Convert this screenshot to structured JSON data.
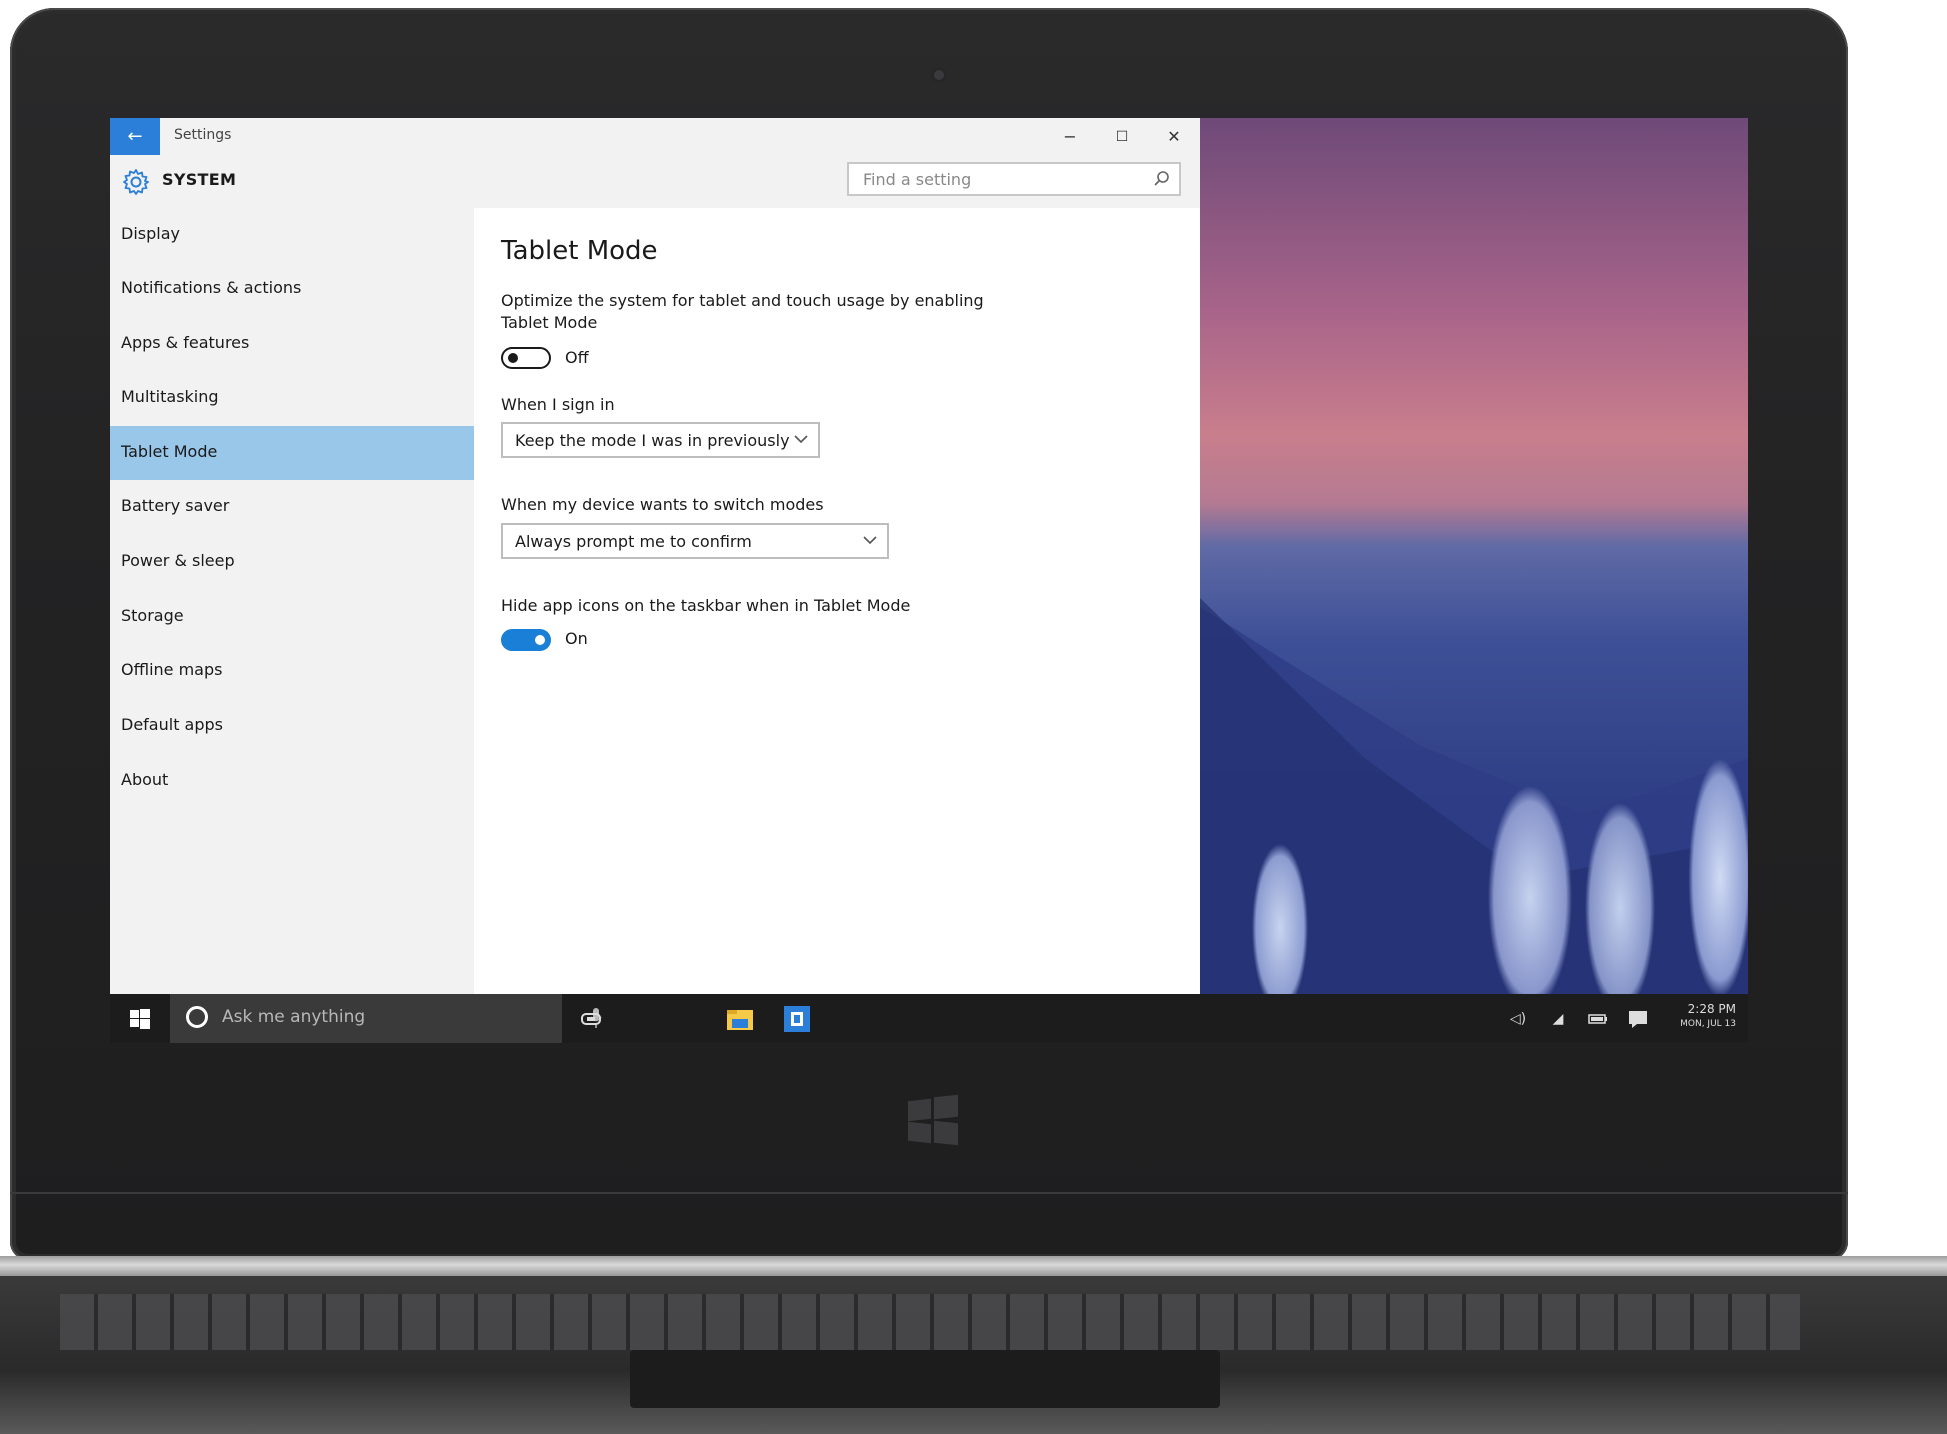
{
  "window": {
    "title": "Settings",
    "back_icon": "←",
    "minimize_icon": "−",
    "maximize_icon": "☐",
    "close_icon": "✕"
  },
  "header": {
    "section": "SYSTEM",
    "search_placeholder": "Find a setting"
  },
  "sidebar": {
    "items": [
      {
        "label": "Display"
      },
      {
        "label": "Notifications & actions"
      },
      {
        "label": "Apps & features"
      },
      {
        "label": "Multitasking"
      },
      {
        "label": "Tablet Mode",
        "selected": true
      },
      {
        "label": "Battery saver"
      },
      {
        "label": "Power & sleep"
      },
      {
        "label": "Storage"
      },
      {
        "label": "Offline maps"
      },
      {
        "label": "Default apps"
      },
      {
        "label": "About"
      }
    ]
  },
  "content": {
    "title": "Tablet Mode",
    "optimize_desc": "Optimize the system for tablet and touch usage by enabling Tablet Mode",
    "tablet_toggle": {
      "state": "Off",
      "on": false
    },
    "signin_label": "When I sign in",
    "signin_value": "Keep the mode I was in previously",
    "switch_label": "When my device wants to switch modes",
    "switch_value": "Always prompt me to confirm",
    "hide_icons_label": "Hide app icons on the taskbar when in Tablet Mode",
    "hide_icons_toggle": {
      "state": "On",
      "on": true
    }
  },
  "taskbar": {
    "search_placeholder": "Ask me anything",
    "clock_time": "2:28 PM",
    "clock_date": "MON, JUL 13",
    "accent": "#1a7fd6"
  },
  "colors": {
    "selection": "#99c7ea",
    "back_button": "#2b7fd8",
    "toggle_on": "#1a7fd6"
  }
}
